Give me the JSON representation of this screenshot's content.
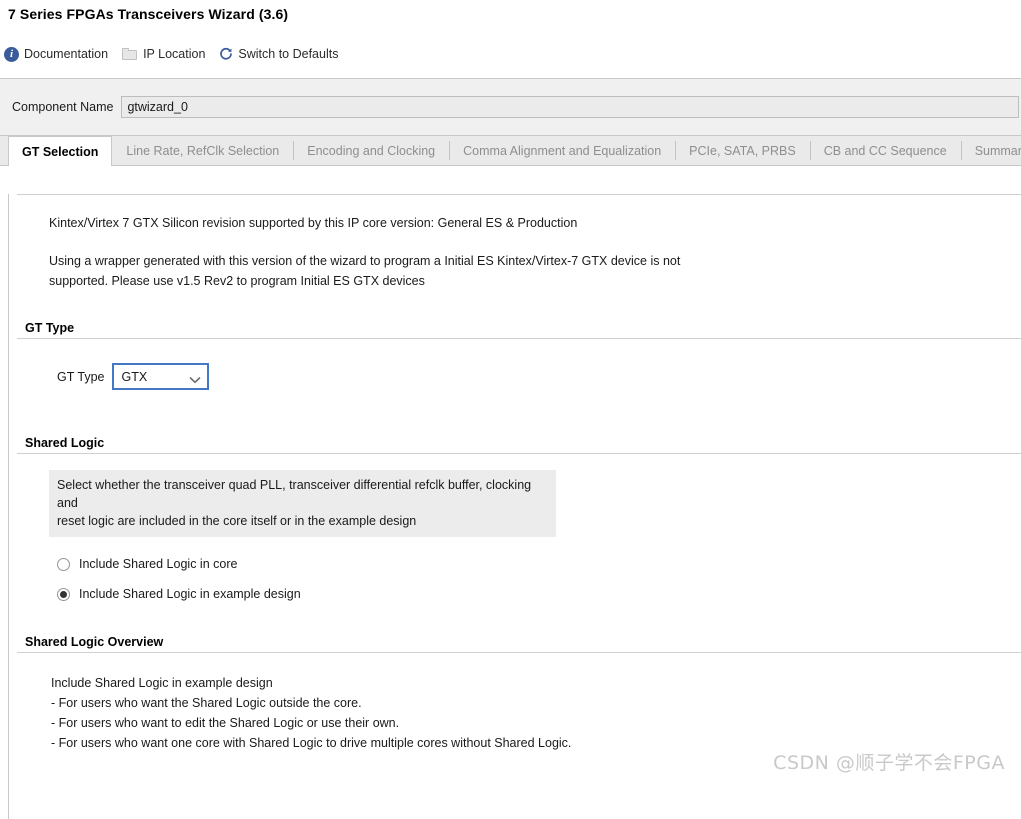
{
  "window": {
    "title": "7 Series FPGAs Transceivers Wizard (3.6)"
  },
  "toolbar": {
    "items": [
      {
        "label": "Documentation",
        "icon": "info-icon",
        "enabled": true
      },
      {
        "label": "IP Location",
        "icon": "folder-icon",
        "enabled": false
      },
      {
        "label": "Switch to Defaults",
        "icon": "refresh-icon",
        "enabled": true
      }
    ]
  },
  "component": {
    "label": "Component Name",
    "value": "gtwizard_0",
    "placeholder": "gtwizard_0"
  },
  "tabs": [
    {
      "label": "GT Selection",
      "active": true
    },
    {
      "label": "Line Rate, RefClk Selection",
      "active": false
    },
    {
      "label": "Encoding and Clocking",
      "active": false
    },
    {
      "label": "Comma Alignment and Equalization",
      "active": false
    },
    {
      "label": "PCIe, SATA, PRBS",
      "active": false
    },
    {
      "label": "CB and CC Sequence",
      "active": false
    },
    {
      "label": "Summary",
      "active": false
    }
  ],
  "info": {
    "line1": "Kintex/Virtex 7 GTX Silicon revision supported by this IP core version: General ES & Production",
    "line2": "Using a wrapper generated with this version of the wizard to program a Initial ES Kintex/Virtex-7 GTX device is not",
    "line3": "supported. Please use v1.5 Rev2 to program Initial ES GTX devices"
  },
  "gt_type": {
    "section_title": "GT Type",
    "field_label": "GT Type",
    "value": "GTX",
    "options": [
      "GTX"
    ]
  },
  "shared_logic": {
    "section_title": "Shared Logic",
    "description_line1": "Select whether the transceiver quad PLL, transceiver differential refclk buffer, clocking and",
    "description_line2": "reset logic are included in the core itself or in the example design",
    "options": [
      {
        "label": "Include Shared Logic in core",
        "selected": false
      },
      {
        "label": "Include Shared Logic in example design",
        "selected": true
      }
    ]
  },
  "overview": {
    "section_title": "Shared Logic Overview",
    "heading": "Include Shared Logic in example design",
    "bullets": [
      "- For users who want the Shared Logic outside the core.",
      "- For users who want to edit the Shared Logic or use their own.",
      "- For users who want one core with Shared Logic to drive multiple cores without Shared Logic."
    ]
  },
  "watermark": {
    "text": "CSDN @顺子学不会FPGA"
  },
  "colors": {
    "accent_blue": "#4477c4",
    "icon_blue": "#3b5b9b",
    "panel_gray": "#f0f0f0",
    "tab_gray": "#eaeaea",
    "desc_gray": "#ececec",
    "border": "#c8c8c8"
  }
}
